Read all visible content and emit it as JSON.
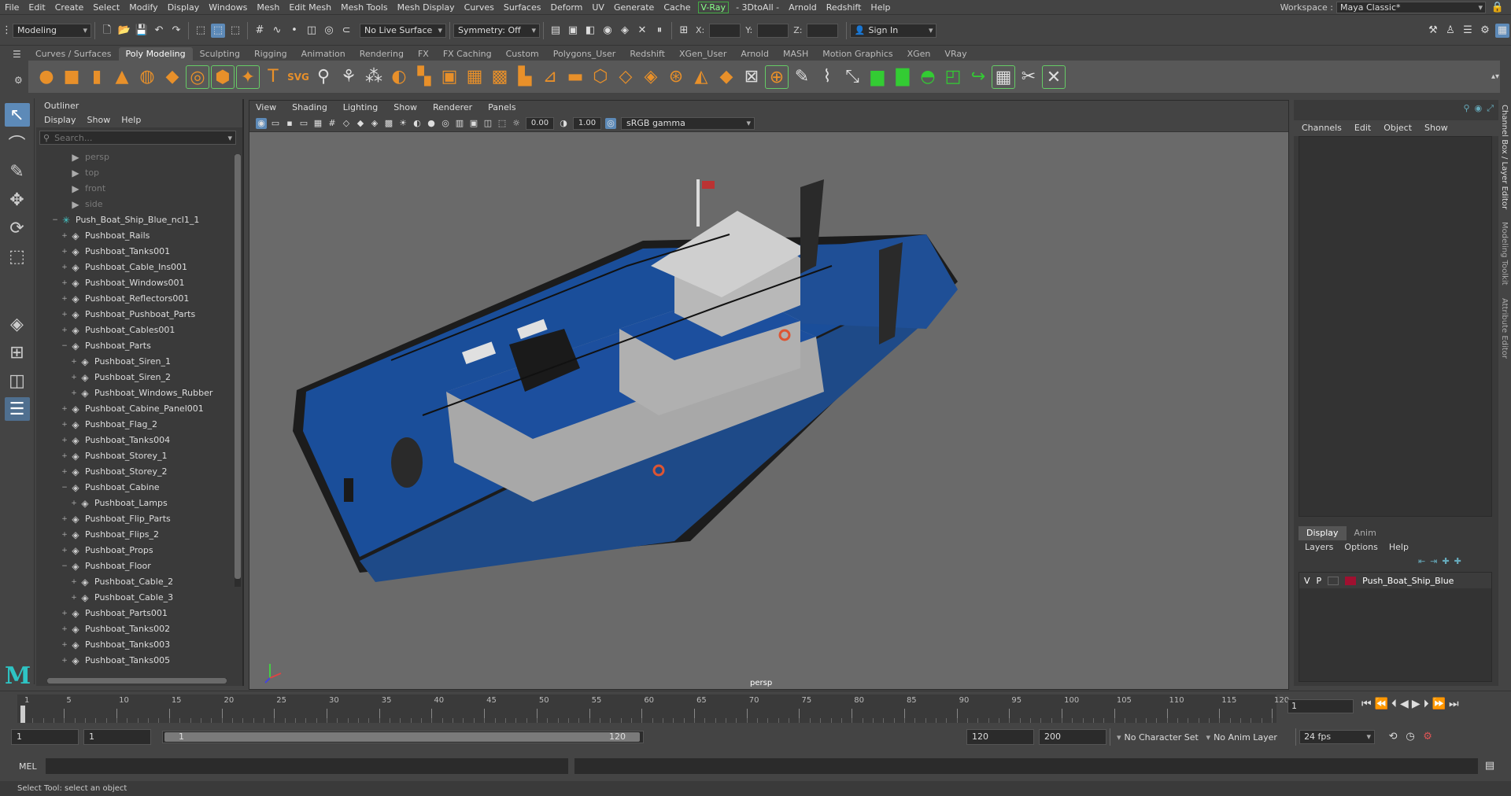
{
  "menubar": {
    "items": [
      "File",
      "Edit",
      "Create",
      "Select",
      "Modify",
      "Display",
      "Windows",
      "Mesh",
      "Edit Mesh",
      "Mesh Tools",
      "Mesh Display",
      "Curves",
      "Surfaces",
      "Deform",
      "UV",
      "Generate",
      "Cache",
      "V-Ray",
      "- 3DtoAll -",
      "Arnold",
      "Redshift",
      "Help"
    ]
  },
  "workspace": {
    "label": "Workspace :",
    "value": "Maya Classic*"
  },
  "status": {
    "mode": "Modeling",
    "live_surface": "No Live Surface",
    "symmetry": "Symmetry: Off",
    "x_label": "X:",
    "y_label": "Y:",
    "z_label": "Z:",
    "sign_in": "Sign In"
  },
  "shelf": {
    "tabs": [
      "Curves / Surfaces",
      "Poly Modeling",
      "Sculpting",
      "Rigging",
      "Animation",
      "Rendering",
      "FX",
      "FX Caching",
      "Custom",
      "Polygons_User",
      "Redshift",
      "XGen_User",
      "Arnold",
      "MASH",
      "Motion Graphics",
      "XGen",
      "VRay"
    ],
    "active": "Poly Modeling"
  },
  "outliner": {
    "title": "Outliner",
    "menu": [
      "Display",
      "Show",
      "Help"
    ],
    "search_placeholder": "Search...",
    "items": [
      {
        "label": "persp",
        "indent": 2,
        "kind": "camera",
        "expand": ""
      },
      {
        "label": "top",
        "indent": 2,
        "kind": "camera",
        "expand": ""
      },
      {
        "label": "front",
        "indent": 2,
        "kind": "camera",
        "expand": ""
      },
      {
        "label": "side",
        "indent": 2,
        "kind": "camera",
        "expand": ""
      },
      {
        "label": "Push_Boat_Ship_Blue_ncl1_1",
        "indent": 1,
        "kind": "group",
        "expand": "−"
      },
      {
        "label": "Pushboat_Rails",
        "indent": 2,
        "kind": "mesh",
        "expand": "+"
      },
      {
        "label": "Pushboat_Tanks001",
        "indent": 2,
        "kind": "mesh",
        "expand": "+"
      },
      {
        "label": "Pushboat_Cable_Ins001",
        "indent": 2,
        "kind": "mesh",
        "expand": "+"
      },
      {
        "label": "Pushboat_Windows001",
        "indent": 2,
        "kind": "mesh",
        "expand": "+"
      },
      {
        "label": "Pushboat_Reflectors001",
        "indent": 2,
        "kind": "mesh",
        "expand": "+"
      },
      {
        "label": "Pushboat_Pushboat_Parts",
        "indent": 2,
        "kind": "mesh",
        "expand": "+"
      },
      {
        "label": "Pushboat_Cables001",
        "indent": 2,
        "kind": "mesh",
        "expand": "+"
      },
      {
        "label": "Pushboat_Parts",
        "indent": 2,
        "kind": "mesh",
        "expand": "−"
      },
      {
        "label": "Pushboat_Siren_1",
        "indent": 3,
        "kind": "mesh",
        "expand": "+"
      },
      {
        "label": "Pushboat_Siren_2",
        "indent": 3,
        "kind": "mesh",
        "expand": "+"
      },
      {
        "label": "Pushboat_Windows_Rubber",
        "indent": 3,
        "kind": "mesh",
        "expand": "+"
      },
      {
        "label": "Pushboat_Cabine_Panel001",
        "indent": 2,
        "kind": "mesh",
        "expand": "+"
      },
      {
        "label": "Pushboat_Flag_2",
        "indent": 2,
        "kind": "mesh",
        "expand": "+"
      },
      {
        "label": "Pushboat_Tanks004",
        "indent": 2,
        "kind": "mesh",
        "expand": "+"
      },
      {
        "label": "Pushboat_Storey_1",
        "indent": 2,
        "kind": "mesh",
        "expand": "+"
      },
      {
        "label": "Pushboat_Storey_2",
        "indent": 2,
        "kind": "mesh",
        "expand": "+"
      },
      {
        "label": "Pushboat_Cabine",
        "indent": 2,
        "kind": "mesh",
        "expand": "−"
      },
      {
        "label": "Pushboat_Lamps",
        "indent": 3,
        "kind": "mesh",
        "expand": "+"
      },
      {
        "label": "Pushboat_Flip_Parts",
        "indent": 2,
        "kind": "mesh",
        "expand": "+"
      },
      {
        "label": "Pushboat_Flips_2",
        "indent": 2,
        "kind": "mesh",
        "expand": "+"
      },
      {
        "label": "Pushboat_Props",
        "indent": 2,
        "kind": "mesh",
        "expand": "+"
      },
      {
        "label": "Pushboat_Floor",
        "indent": 2,
        "kind": "mesh",
        "expand": "−"
      },
      {
        "label": "Pushboat_Cable_2",
        "indent": 3,
        "kind": "mesh",
        "expand": "+"
      },
      {
        "label": "Pushboat_Cable_3",
        "indent": 3,
        "kind": "mesh",
        "expand": "+"
      },
      {
        "label": "Pushboat_Parts001",
        "indent": 2,
        "kind": "mesh",
        "expand": "+"
      },
      {
        "label": "Pushboat_Tanks002",
        "indent": 2,
        "kind": "mesh",
        "expand": "+"
      },
      {
        "label": "Pushboat_Tanks003",
        "indent": 2,
        "kind": "mesh",
        "expand": "+"
      },
      {
        "label": "Pushboat_Tanks005",
        "indent": 2,
        "kind": "mesh",
        "expand": "+"
      }
    ]
  },
  "viewport": {
    "menu": [
      "View",
      "Shading",
      "Lighting",
      "Show",
      "Renderer",
      "Panels"
    ],
    "exposure": "0.00",
    "gamma": "1.00",
    "colorspace": "sRGB gamma",
    "camera": "persp"
  },
  "channelbox": {
    "menu": [
      "Channels",
      "Edit",
      "Object",
      "Show"
    ],
    "tabs": [
      "Display",
      "Anim"
    ],
    "layer_menu": [
      "Layers",
      "Options",
      "Help"
    ],
    "layer": {
      "v": "V",
      "p": "P",
      "name": "Push_Boat_Ship_Blue",
      "color": "#a01030"
    }
  },
  "sidetabs": [
    "Channel Box / Layer Editor",
    "Modeling Toolkit",
    "Attribute Editor"
  ],
  "timeline": {
    "ticks": [
      1,
      5,
      10,
      15,
      20,
      25,
      30,
      35,
      40,
      45,
      50,
      55,
      60,
      65,
      70,
      75,
      80,
      85,
      90,
      95,
      100,
      105,
      110,
      115,
      120
    ],
    "current": "1",
    "min": 1,
    "max": 120
  },
  "range": {
    "start": "1",
    "start2": "1",
    "inner_start": "1",
    "inner_end": "120",
    "end": "120",
    "end2": "200",
    "character_set": "No Character Set",
    "anim_layer": "No Anim Layer",
    "fps": "24 fps"
  },
  "cmd": {
    "label": "MEL"
  },
  "help": {
    "text": "Select Tool: select an object"
  }
}
